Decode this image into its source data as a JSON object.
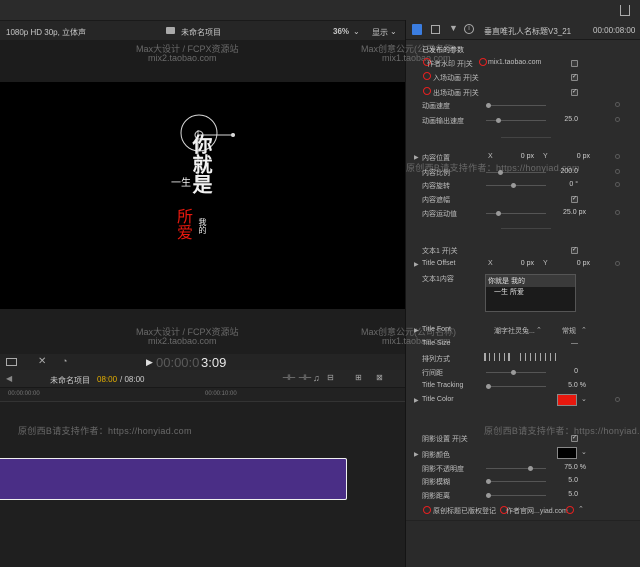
{
  "topbar": {
    "format": "1080p HD 30p, 立体声",
    "project_title": "未命名项目",
    "zoom": "36%",
    "display_menu": "显示",
    "inspector_title": "垂直唯孔人名标题V3_21",
    "inspector_time": "00:00:08:00"
  },
  "watermarks": {
    "line1": "Max大设计 / FCPX资源站",
    "line1b": "mix2.taobao.com",
    "line2": "Max创意公元(公司名称)",
    "line2b": "mix1.taobao.com",
    "line3": "原创西B请支持作者：https://honyiad.com",
    "line4": "原创西B请支持作者：https://honyiad.com",
    "line5": "原创西B请支持作者：https://honyiad.com"
  },
  "viewer": {
    "title_line1": "你就是",
    "title_line2": "一生",
    "title_line3": "所爱",
    "title_small": "我的"
  },
  "transport": {
    "timecode_dim": "00:00:0",
    "timecode_bright": "3:09"
  },
  "timeline": {
    "project": "未命名项目",
    "current": "08:00",
    "total": "/ 08:00",
    "ruler_start": "00:00:00:00",
    "ruler_mid": "00:00:10:00"
  },
  "inspector": {
    "section_published": "已发布的参数",
    "rows": [
      {
        "label": "作者水印 开|关",
        "extra": "mix1.taobao.com"
      },
      {
        "label": "入场动画 开|关"
      },
      {
        "label": "出场动画 开|关"
      },
      {
        "label": "动画速度"
      },
      {
        "label": "动画输出速度",
        "value": "25.0"
      },
      {
        "label": "内容位置",
        "x_label": "X",
        "x_value": "0 px",
        "y_label": "Y",
        "y_value": "0 px"
      },
      {
        "label": "内容比例",
        "value": "200.0"
      },
      {
        "label": "内容旋转",
        "value": "0 °"
      },
      {
        "label": "内容遮幅"
      },
      {
        "label": "内容运动值",
        "value": "25.0 px"
      },
      {
        "label": "文本1 开|关"
      },
      {
        "label": "Title Offset",
        "x_label": "X",
        "x_value": "0 px",
        "y_label": "Y",
        "y_value": "0 px"
      },
      {
        "label": "文本1内容"
      },
      {
        "label": "Title Font",
        "font_value": "潮字社灵兔...",
        "style_value": "常规"
      },
      {
        "label": "Title Size",
        "value": "—"
      },
      {
        "label": "排列方式"
      },
      {
        "label": "行间距",
        "value": "0"
      },
      {
        "label": "Title Tracking",
        "value": "5.0 %"
      },
      {
        "label": "Title Color"
      },
      {
        "label": "阴影设置 开|关"
      },
      {
        "label": "阴影颜色"
      },
      {
        "label": "阴影不透明度",
        "value": "75.0 %"
      },
      {
        "label": "阴影模糊",
        "value": "5.0"
      },
      {
        "label": "阴影距离",
        "value": "5.0"
      },
      {
        "label": "原创标题已版权登记",
        "extra": "作者官网...yiad.com"
      }
    ],
    "text_content_line1": "你就是 我的",
    "text_content_line2": "一生 所爱"
  },
  "colors": {
    "title_color": "#e8180e",
    "shadow_color": "#000000",
    "clip_purple": "#4a2e86",
    "accent_blue": "#3b7de0",
    "annotation_red": "#e52020"
  },
  "icons": [
    "film-icon",
    "filter-icon",
    "info-icon",
    "share-icon",
    "play-icon",
    "fullscreen-icon",
    "arrow-tool-icon",
    "speed-icon",
    "headphones-icon",
    "snap-icon"
  ]
}
